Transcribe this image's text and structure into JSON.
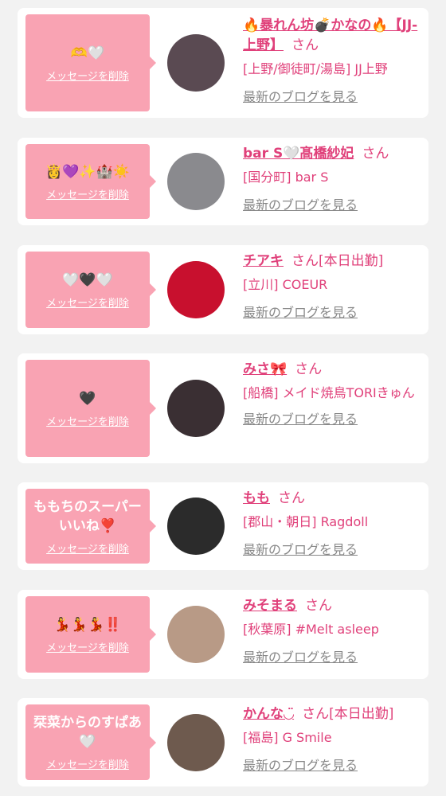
{
  "items": [
    {
      "message": "🫶🤍",
      "delete_label": "メッセージを削除",
      "name": "🔥暴れん坊💣かなの🔥【JJ-上野】",
      "suffix": "さん",
      "extra": "",
      "area": "[上野/御徒町/湯島] JJ上野",
      "blog_link": "最新のブログを見る",
      "avatar_color": "#5a4a52"
    },
    {
      "message": "👸💜✨🏰☀️",
      "delete_label": "メッセージを削除",
      "name": "bar S🤍髙橋紗妃",
      "suffix": "さん",
      "extra": "",
      "area": "[国分町] bar S",
      "blog_link": "最新のブログを見る",
      "avatar_color": "#8a8a8e"
    },
    {
      "message": "🤍🖤🤍",
      "delete_label": "メッセージを削除",
      "name": "チアキ",
      "suffix": "さん",
      "extra": "[本日出勤]",
      "area": "[立川] COEUR",
      "blog_link": "最新のブログを見る",
      "avatar_color": "#c8102e"
    },
    {
      "message": "🖤",
      "delete_label": "メッセージを削除",
      "name": "みさ🎀",
      "suffix": "さん",
      "extra": "",
      "area": "[船橋] メイド焼鳥TORIきゅん",
      "blog_link": "最新のブログを見る",
      "avatar_color": "#3a2f33"
    },
    {
      "message": "ももちのスーパーいいね❣️",
      "delete_label": "メッセージを削除",
      "name": "もも",
      "suffix": "さん",
      "extra": "",
      "area": "[郡山・朝日] Ragdoll",
      "blog_link": "最新のブログを見る",
      "avatar_color": "#2b2b2b"
    },
    {
      "message": "💃💃💃‼️",
      "delete_label": "メッセージを削除",
      "name": "みそまる",
      "suffix": "さん",
      "extra": "",
      "area": "[秋葉原] #Melt asleep",
      "blog_link": "最新のブログを見る",
      "avatar_color": "#b89a86"
    },
    {
      "message": "栞菜からのすぱあ🤍",
      "delete_label": "メッセージを削除",
      "name": "かんな◡̈",
      "suffix": "さん",
      "extra": "[本日出勤]",
      "area": "[福島] G Smile",
      "blog_link": "最新のブログを見る",
      "avatar_color": "#6e5a4e"
    }
  ]
}
